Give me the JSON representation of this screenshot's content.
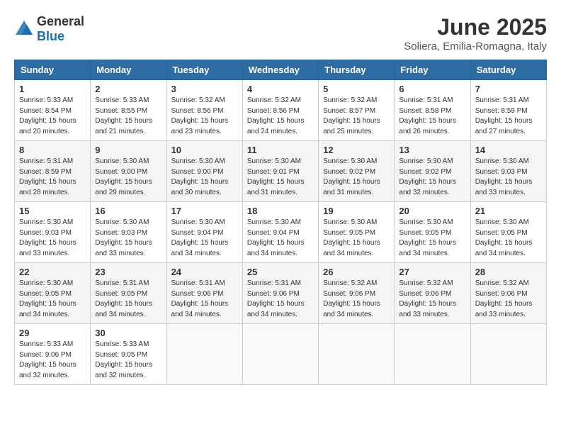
{
  "header": {
    "logo": {
      "general": "General",
      "blue": "Blue"
    },
    "title": "June 2025",
    "subtitle": "Soliera, Emilia-Romagna, Italy"
  },
  "days_of_week": [
    "Sunday",
    "Monday",
    "Tuesday",
    "Wednesday",
    "Thursday",
    "Friday",
    "Saturday"
  ],
  "weeks": [
    [
      {
        "day": "1",
        "sunrise": "5:33 AM",
        "sunset": "8:54 PM",
        "daylight": "15 hours and 20 minutes."
      },
      {
        "day": "2",
        "sunrise": "5:33 AM",
        "sunset": "8:55 PM",
        "daylight": "15 hours and 21 minutes."
      },
      {
        "day": "3",
        "sunrise": "5:32 AM",
        "sunset": "8:56 PM",
        "daylight": "15 hours and 23 minutes."
      },
      {
        "day": "4",
        "sunrise": "5:32 AM",
        "sunset": "8:56 PM",
        "daylight": "15 hours and 24 minutes."
      },
      {
        "day": "5",
        "sunrise": "5:32 AM",
        "sunset": "8:57 PM",
        "daylight": "15 hours and 25 minutes."
      },
      {
        "day": "6",
        "sunrise": "5:31 AM",
        "sunset": "8:58 PM",
        "daylight": "15 hours and 26 minutes."
      },
      {
        "day": "7",
        "sunrise": "5:31 AM",
        "sunset": "8:59 PM",
        "daylight": "15 hours and 27 minutes."
      }
    ],
    [
      {
        "day": "8",
        "sunrise": "5:31 AM",
        "sunset": "8:59 PM",
        "daylight": "15 hours and 28 minutes."
      },
      {
        "day": "9",
        "sunrise": "5:30 AM",
        "sunset": "9:00 PM",
        "daylight": "15 hours and 29 minutes."
      },
      {
        "day": "10",
        "sunrise": "5:30 AM",
        "sunset": "9:00 PM",
        "daylight": "15 hours and 30 minutes."
      },
      {
        "day": "11",
        "sunrise": "5:30 AM",
        "sunset": "9:01 PM",
        "daylight": "15 hours and 31 minutes."
      },
      {
        "day": "12",
        "sunrise": "5:30 AM",
        "sunset": "9:02 PM",
        "daylight": "15 hours and 31 minutes."
      },
      {
        "day": "13",
        "sunrise": "5:30 AM",
        "sunset": "9:02 PM",
        "daylight": "15 hours and 32 minutes."
      },
      {
        "day": "14",
        "sunrise": "5:30 AM",
        "sunset": "9:03 PM",
        "daylight": "15 hours and 33 minutes."
      }
    ],
    [
      {
        "day": "15",
        "sunrise": "5:30 AM",
        "sunset": "9:03 PM",
        "daylight": "15 hours and 33 minutes."
      },
      {
        "day": "16",
        "sunrise": "5:30 AM",
        "sunset": "9:03 PM",
        "daylight": "15 hours and 33 minutes."
      },
      {
        "day": "17",
        "sunrise": "5:30 AM",
        "sunset": "9:04 PM",
        "daylight": "15 hours and 34 minutes."
      },
      {
        "day": "18",
        "sunrise": "5:30 AM",
        "sunset": "9:04 PM",
        "daylight": "15 hours and 34 minutes."
      },
      {
        "day": "19",
        "sunrise": "5:30 AM",
        "sunset": "9:05 PM",
        "daylight": "15 hours and 34 minutes."
      },
      {
        "day": "20",
        "sunrise": "5:30 AM",
        "sunset": "9:05 PM",
        "daylight": "15 hours and 34 minutes."
      },
      {
        "day": "21",
        "sunrise": "5:30 AM",
        "sunset": "9:05 PM",
        "daylight": "15 hours and 34 minutes."
      }
    ],
    [
      {
        "day": "22",
        "sunrise": "5:30 AM",
        "sunset": "9:05 PM",
        "daylight": "15 hours and 34 minutes."
      },
      {
        "day": "23",
        "sunrise": "5:31 AM",
        "sunset": "9:05 PM",
        "daylight": "15 hours and 34 minutes."
      },
      {
        "day": "24",
        "sunrise": "5:31 AM",
        "sunset": "9:06 PM",
        "daylight": "15 hours and 34 minutes."
      },
      {
        "day": "25",
        "sunrise": "5:31 AM",
        "sunset": "9:06 PM",
        "daylight": "15 hours and 34 minutes."
      },
      {
        "day": "26",
        "sunrise": "5:32 AM",
        "sunset": "9:06 PM",
        "daylight": "15 hours and 34 minutes."
      },
      {
        "day": "27",
        "sunrise": "5:32 AM",
        "sunset": "9:06 PM",
        "daylight": "15 hours and 33 minutes."
      },
      {
        "day": "28",
        "sunrise": "5:32 AM",
        "sunset": "9:06 PM",
        "daylight": "15 hours and 33 minutes."
      }
    ],
    [
      {
        "day": "29",
        "sunrise": "5:33 AM",
        "sunset": "9:06 PM",
        "daylight": "15 hours and 32 minutes."
      },
      {
        "day": "30",
        "sunrise": "5:33 AM",
        "sunset": "9:05 PM",
        "daylight": "15 hours and 32 minutes."
      },
      null,
      null,
      null,
      null,
      null
    ]
  ]
}
